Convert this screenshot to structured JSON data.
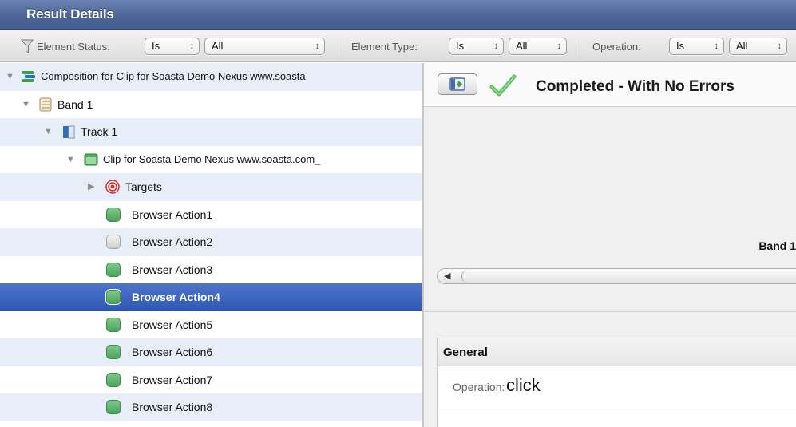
{
  "header": {
    "title": "Result Details"
  },
  "filters": {
    "element_status": {
      "label": "Element Status:",
      "operator": "Is",
      "value": "All"
    },
    "element_type": {
      "label": "Element Type:",
      "operator": "Is",
      "value": "All"
    },
    "operation": {
      "label": "Operation:",
      "operator": "Is",
      "value": "All"
    },
    "arrows": "↕"
  },
  "tree": {
    "composition": "Composition for Clip for Soasta Demo Nexus www.soasta",
    "band": "Band 1",
    "track": "Track 1",
    "clip": "Clip for Soasta Demo Nexus www.soasta.com_",
    "targets": "Targets",
    "actions": [
      {
        "label": "Browser Action1",
        "status": "green"
      },
      {
        "label": "Browser Action2",
        "status": "grey"
      },
      {
        "label": "Browser Action3",
        "status": "green"
      },
      {
        "label": "Browser Action4",
        "status": "green",
        "selected": true
      },
      {
        "label": "Browser Action5",
        "status": "green"
      },
      {
        "label": "Browser Action6",
        "status": "green"
      },
      {
        "label": "Browser Action7",
        "status": "green"
      },
      {
        "label": "Browser Action8",
        "status": "green"
      }
    ]
  },
  "detail": {
    "status": "Completed - With No Errors",
    "band_label": "Band 1",
    "general": {
      "title": "General",
      "operation_label": "Operation:",
      "operation_value": "click"
    }
  },
  "colors": {
    "title_bar": "#4d669a",
    "selection": "#3a62c0",
    "row_alt": "#e8eef8",
    "status_green": "#5cb067"
  },
  "icons": [
    "funnel-icon",
    "disclosure-triangle-icon",
    "composition-icon",
    "band-icon",
    "track-icon",
    "clip-icon",
    "target-icon",
    "status-dot-icon",
    "expand-panel-icon",
    "checkmark-icon",
    "scroll-left-icon"
  ]
}
